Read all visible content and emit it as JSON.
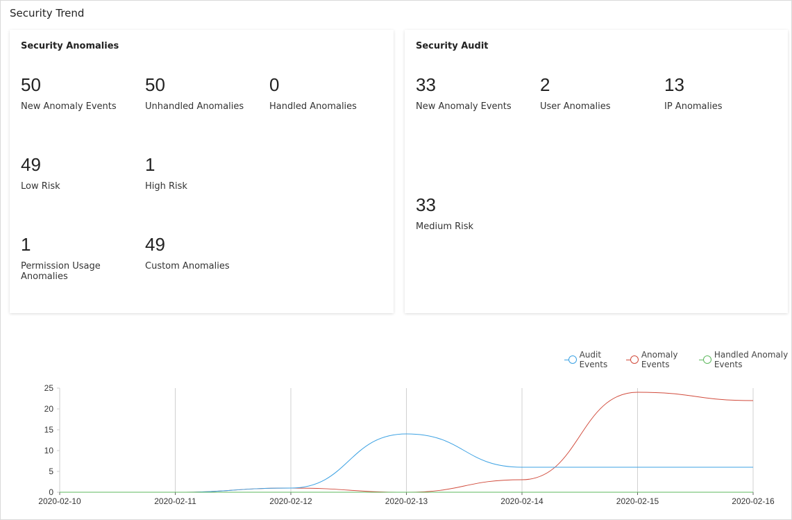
{
  "page": {
    "title": "Security Trend"
  },
  "anomaly_card": {
    "title": "Security Anomalies",
    "metrics": [
      {
        "value": "50",
        "label": "New Anomaly Events"
      },
      {
        "value": "50",
        "label": "Unhandled Anomalies"
      },
      {
        "value": "0",
        "label": "Handled Anomalies"
      },
      {
        "value": "49",
        "label": "Low Risk"
      },
      {
        "value": "1",
        "label": "High Risk"
      },
      {
        "value": "1",
        "label": "Permission Usage Anomalies"
      },
      {
        "value": "49",
        "label": "Custom Anomalies"
      }
    ]
  },
  "audit_card": {
    "title": "Security Audit",
    "metrics": [
      {
        "value": "33",
        "label": "New Anomaly Events"
      },
      {
        "value": "2",
        "label": "User Anomalies"
      },
      {
        "value": "13",
        "label": "IP Anomalies"
      },
      {
        "value": "33",
        "label": "Medium Risk"
      }
    ]
  },
  "chart_data": {
    "type": "line",
    "smooth": true,
    "x": [
      "2020-02-10",
      "2020-02-11",
      "2020-02-12",
      "2020-02-13",
      "2020-02-14",
      "2020-02-15",
      "2020-02-16"
    ],
    "series": [
      {
        "name": "Audit Events",
        "color": "#3ba1e3",
        "values": [
          0,
          0,
          1,
          14,
          6,
          6,
          6
        ]
      },
      {
        "name": "Anomaly Events",
        "color": "#d14a3b",
        "values": [
          0,
          0,
          1,
          0,
          3,
          24,
          22
        ]
      },
      {
        "name": "Handled Anomaly Events",
        "color": "#5cb85c",
        "values": [
          0,
          0,
          0,
          0,
          0,
          0,
          0
        ]
      }
    ],
    "ylim": [
      0,
      25
    ],
    "yticks": [
      0,
      5,
      10,
      15,
      20,
      25
    ],
    "grid": "vertical",
    "legend_position": "top-right"
  }
}
